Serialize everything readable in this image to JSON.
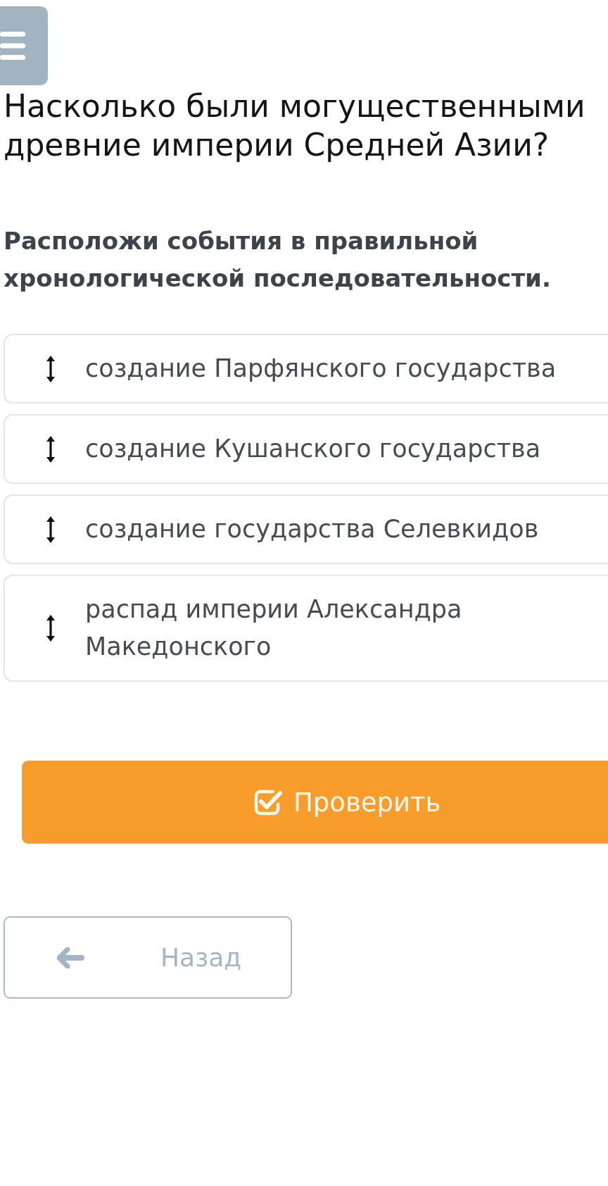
{
  "question": {
    "title": "Насколько были могущественными древние империи Средней Азии?"
  },
  "task": {
    "instruction": "Расположи события в правильной хронологической последовательности."
  },
  "events": [
    {
      "text": "создание Парфянского государства"
    },
    {
      "text": "создание Кушанского государства"
    },
    {
      "text": "создание государства Селевкидов"
    },
    {
      "text": "распад империи Александра Македонского"
    }
  ],
  "buttons": {
    "check": "Проверить",
    "back": "Назад"
  }
}
